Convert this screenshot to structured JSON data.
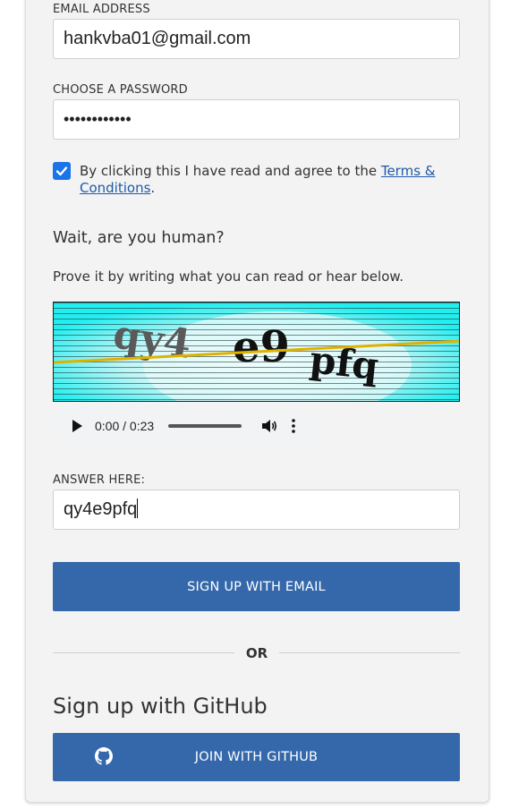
{
  "email": {
    "label": "EMAIL ADDRESS",
    "value": "hankvba01@gmail.com"
  },
  "password": {
    "label": "CHOOSE A PASSWORD",
    "value": "••••••••••••"
  },
  "agree": {
    "checked": true,
    "text": "By clicking this I have read and agree to the ",
    "link_text": "Terms & Conditions",
    "end": "."
  },
  "captcha": {
    "heading": "Wait, are you human?",
    "instructions": "Prove it by writing what you can read or hear below.",
    "image_text": "qy4e9pfq",
    "audio": {
      "time": "0:00 / 0:23",
      "play_icon": "play-icon",
      "volume_icon": "volume-icon",
      "more_icon": "more-vertical-icon"
    }
  },
  "answer": {
    "label": "ANSWER HERE:",
    "value": "qy4e9pfq"
  },
  "signup_email_button": "SIGN UP WITH EMAIL",
  "divider": "OR",
  "github": {
    "title": "Sign up with GitHub",
    "button": "JOIN WITH GITHUB",
    "icon": "github-icon"
  },
  "colors": {
    "button": "#3468ab",
    "link": "#1f5aa6",
    "checkbox": "#1a73e8",
    "captcha_bg": "#22eef0"
  }
}
